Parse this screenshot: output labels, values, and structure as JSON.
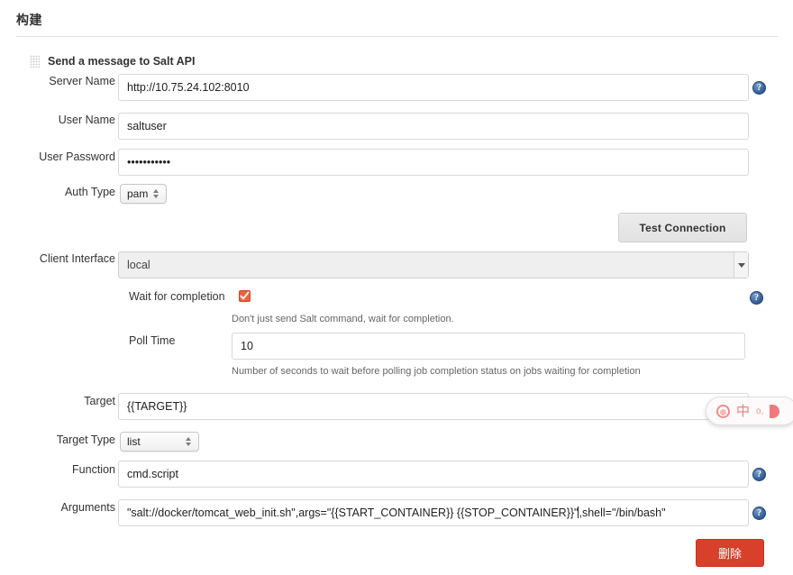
{
  "section": {
    "title": "构建"
  },
  "block": {
    "handle_icon": "drag-grid-icon",
    "title": "Send a message to Salt API"
  },
  "fields": {
    "server_name": {
      "label": "Server Name",
      "value": "http://10.75.24.102:8010",
      "help": "?"
    },
    "user_name": {
      "label": "User Name",
      "value": "saltuser"
    },
    "user_password": {
      "label": "User Password",
      "value": "•••••••••••",
      "masked_char_count": 11
    },
    "auth_type": {
      "label": "Auth Type",
      "value": "pam"
    },
    "client_interface": {
      "label": "Client Interface",
      "value": "local"
    },
    "wait_for_completion": {
      "label": "Wait for completion",
      "checked": true,
      "hint": "Don't just send Salt command, wait for completion.",
      "help": "?"
    },
    "poll_time": {
      "label": "Poll Time",
      "value": "10",
      "hint": "Number of seconds to wait before polling job completion status on jobs waiting for completion"
    },
    "target": {
      "label": "Target",
      "value": "{{TARGET}}"
    },
    "target_type": {
      "label": "Target Type",
      "value": "list"
    },
    "function": {
      "label": "Function",
      "value": "cmd.script",
      "help": "?"
    },
    "arguments": {
      "label": "Arguments",
      "value_before_caret": "\"salt://docker/tomcat_web_init.sh\",args=\"{{START_CONTAINER}} {{STOP_CONTAINER}}\"",
      "value_after_caret": ",shell=\"/bin/bash\"",
      "value": "\"salt://docker/tomcat_web_init.sh\",args=\"{{START_CONTAINER}} {{STOP_CONTAINER}}\",shell=\"/bin/bash\"",
      "help": "?"
    }
  },
  "buttons": {
    "test_connection": "Test Connection",
    "delete": "删除"
  },
  "ime": {
    "logo_icon": "sogou-logo-icon",
    "mode": "中",
    "punctuation_icon": "punctuation-toggle-icon",
    "keyboard_icon": "soft-keyboard-icon"
  },
  "colors": {
    "accent_red": "#d9402b",
    "checkbox_orange": "#e8643f",
    "help_blue": "#2d5b96"
  }
}
